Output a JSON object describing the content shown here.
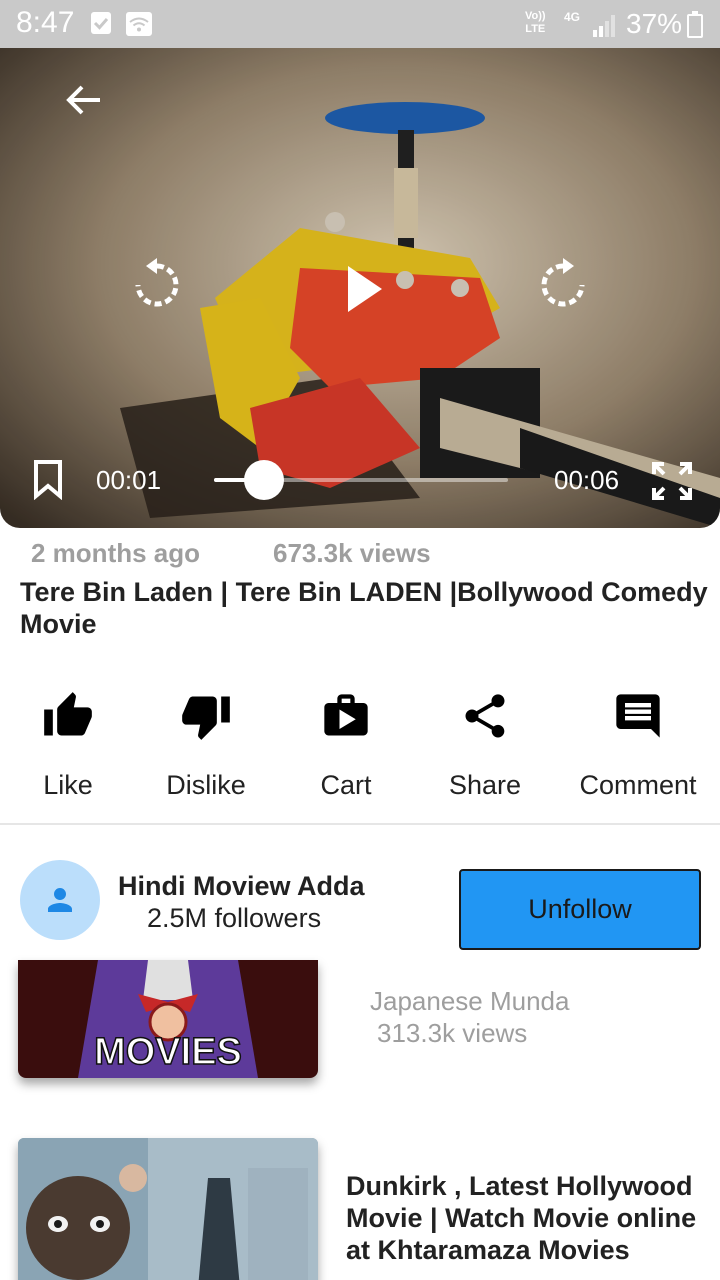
{
  "status_bar": {
    "time": "8:47",
    "volte": "Vo)) LTE",
    "network": "4G",
    "battery": "37%"
  },
  "player": {
    "current_time": "00:01",
    "total_time": "00:06",
    "progress": 0.17,
    "icons": [
      "back-arrow-icon",
      "rewind-icon",
      "play-icon",
      "forward-icon",
      "bookmark-icon",
      "fullscreen-icon"
    ]
  },
  "video": {
    "posted": "2 months ago",
    "views": "673.3k views",
    "title": "Tere Bin Laden  | Tere Bin LADEN |Bollywood Comedy Movie"
  },
  "actions": {
    "like": "Like",
    "dislike": "Dislike",
    "cart": "Cart",
    "share": "Share",
    "comment": "Comment"
  },
  "channel": {
    "name": "Hindi Moview Adda",
    "followers": "2.5M followers",
    "unfollow_label": "Unfollow"
  },
  "related": [
    {
      "thumb_text": "MOVIES",
      "channel": "Japanese Munda",
      "views": "313.3k views"
    },
    {
      "title": "Dunkirk , Latest Hollywood Movie  | Watch Movie online at Khtaramaza Movies"
    }
  ],
  "colors": {
    "status_bar": "#c9c9c9",
    "unfollow_button": "#2196f3",
    "avatar_bg": "#bbdefb",
    "avatar_icon": "#1e88e5",
    "muted_text": "#9e9e9e"
  }
}
